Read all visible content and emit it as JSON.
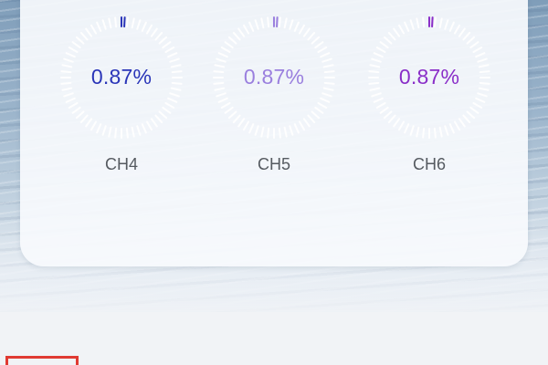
{
  "channels": [
    {
      "label": "CH4",
      "value": "0.87%",
      "level": 0.0087,
      "color": "#2a35b8"
    },
    {
      "label": "CH5",
      "value": "0.87%",
      "level": 0.0087,
      "color": "#9a7fde"
    },
    {
      "label": "CH6",
      "value": "0.87%",
      "level": 0.0087,
      "color": "#8a2ec8"
    }
  ],
  "colors": {
    "tick": "#ffffff",
    "highlight": "#e03a32"
  }
}
